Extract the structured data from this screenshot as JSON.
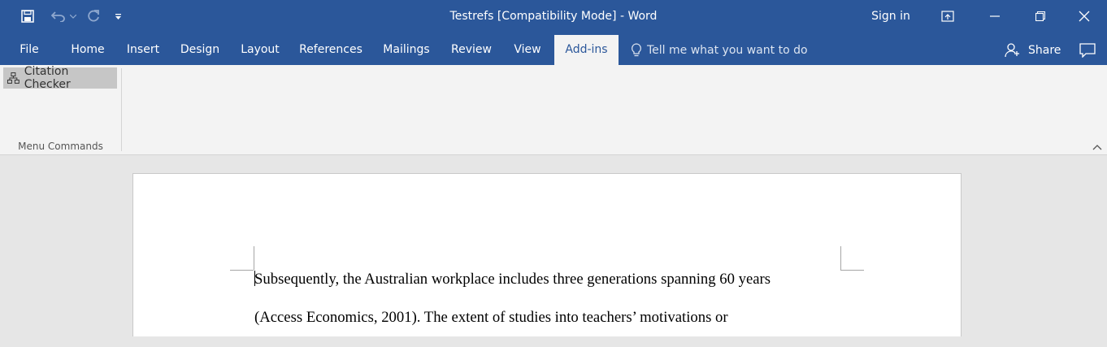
{
  "window": {
    "title": "Testrefs [Compatibility Mode]  -  Word",
    "sign_in": "Sign in"
  },
  "quick_access": {
    "icons": [
      "save-icon",
      "undo-icon",
      "undo-dropdown-icon",
      "redo-icon",
      "customize-toolbar-icon"
    ]
  },
  "tabs": [
    {
      "label": "File",
      "active": false
    },
    {
      "label": "Home",
      "active": false
    },
    {
      "label": "Insert",
      "active": false
    },
    {
      "label": "Design",
      "active": false
    },
    {
      "label": "Layout",
      "active": false
    },
    {
      "label": "References",
      "active": false
    },
    {
      "label": "Mailings",
      "active": false
    },
    {
      "label": "Review",
      "active": false
    },
    {
      "label": "View",
      "active": false
    },
    {
      "label": "Add-ins",
      "active": true
    }
  ],
  "tell_me": {
    "placeholder": "Tell me what you want to do"
  },
  "share": {
    "label": "Share"
  },
  "ribbon": {
    "citation_checker": "Citation Checker",
    "group_label": "Menu Commands"
  },
  "document": {
    "lines": [
      "Subsequently, the Australian workplace includes three generations spanning 60 years",
      "(Access Economics, 2001).  The extent of studies into teachers’ motivations or"
    ]
  },
  "colors": {
    "title_bar": "#2b579a",
    "ribbon": "#f3f3f3",
    "workspace": "#e6e6e6"
  }
}
